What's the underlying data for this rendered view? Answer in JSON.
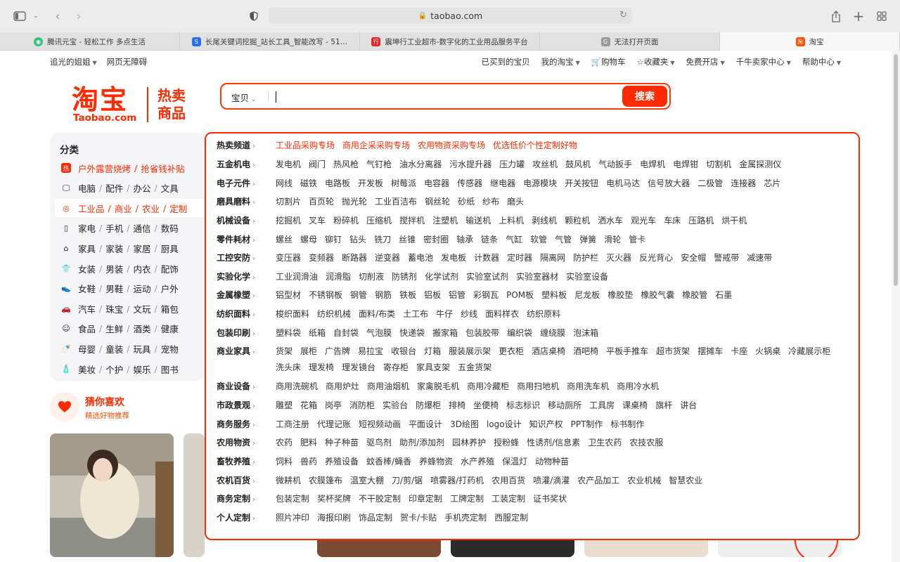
{
  "browser": {
    "url": "taobao.com",
    "tabs": [
      {
        "title": "腾讯元宝 - 轻松工作 多点生活",
        "color": "#31c27c",
        "glyph": "◉"
      },
      {
        "title": "长尾关键词挖掘_站长工具_智能改写 - 51…",
        "color": "#2b6ef2",
        "glyph": "S"
      },
      {
        "title": "震坤行工业超市-数字化的工业用品服务平台",
        "color": "#e3262b",
        "glyph": "行"
      },
      {
        "title": "无法打开页面",
        "color": "#9a9a9a",
        "glyph": "G"
      },
      {
        "title": "淘宝",
        "color": "#ff5000",
        "glyph": "淘"
      }
    ]
  },
  "topnav": {
    "left": [
      "追光的姐姐",
      "网页无障碍"
    ],
    "right": [
      "已买到的宝贝",
      "我的淘宝",
      "购物车",
      "收藏夹",
      "免费开店",
      "千牛卖家中心",
      "帮助中心"
    ]
  },
  "logo": {
    "main": "淘宝",
    "sub": "Taobao.com",
    "hot1": "热卖",
    "hot2": "商品"
  },
  "search": {
    "scope": "宝贝",
    "placeholder": "",
    "button": "搜索"
  },
  "categories": {
    "title": "分类",
    "rows": [
      {
        "icon": "hot",
        "items": [
          "户外露营烧烤",
          "抢省钱补贴"
        ]
      },
      {
        "icon": "monitor",
        "items": [
          "电脑",
          "配件",
          "办公",
          "文具"
        ]
      },
      {
        "icon": "target",
        "items": [
          "工业品",
          "商业",
          "农业",
          "定制"
        ]
      },
      {
        "icon": "phone",
        "items": [
          "家电",
          "手机",
          "通信",
          "数码"
        ]
      },
      {
        "icon": "sofa",
        "items": [
          "家具",
          "家装",
          "家居",
          "厨具"
        ]
      },
      {
        "icon": "shirt",
        "items": [
          "女装",
          "男装",
          "内衣",
          "配饰"
        ]
      },
      {
        "icon": "shoe",
        "items": [
          "女鞋",
          "男鞋",
          "运动",
          "户外"
        ]
      },
      {
        "icon": "car",
        "items": [
          "汽车",
          "珠宝",
          "文玩",
          "箱包"
        ]
      },
      {
        "icon": "food",
        "items": [
          "食品",
          "生鲜",
          "酒类",
          "健康"
        ]
      },
      {
        "icon": "baby",
        "items": [
          "母婴",
          "童装",
          "玩具",
          "宠物"
        ]
      },
      {
        "icon": "cosmetic",
        "items": [
          "美妆",
          "个护",
          "娱乐",
          "图书"
        ]
      }
    ]
  },
  "guess": {
    "title": "猜你喜欢",
    "sub": "精选好物推荐"
  },
  "panel": [
    {
      "label": "热卖频道",
      "items": [
        "工业品采购专场",
        "商用企采采购专场",
        "农用物资采购专场",
        "优选低价个性定制好物"
      ]
    },
    {
      "label": "五金机电",
      "items": [
        "发电机",
        "阀门",
        "热风枪",
        "气钉枪",
        "油水分离器",
        "污水提升器",
        "压力罐",
        "攻丝机",
        "鼓风机",
        "气动扳手",
        "电焊机",
        "电焊钳",
        "切割机",
        "金属探测仪"
      ]
    },
    {
      "label": "电子元件",
      "items": [
        "网线",
        "磁铁",
        "电路板",
        "开发板",
        "树莓派",
        "电容器",
        "传感器",
        "继电器",
        "电源模块",
        "开关按钮",
        "电机马达",
        "信号放大器",
        "二极管",
        "连接器",
        "芯片"
      ]
    },
    {
      "label": "磨具磨料",
      "items": [
        "切割片",
        "百页轮",
        "抛光轮",
        "工业百洁布",
        "钢丝轮",
        "砂纸",
        "纱布",
        "磨头"
      ]
    },
    {
      "label": "机械设备",
      "items": [
        "挖掘机",
        "叉车",
        "粉碎机",
        "压缩机",
        "搅拌机",
        "注塑机",
        "输送机",
        "上料机",
        "剥线机",
        "颗粒机",
        "洒水车",
        "观光车",
        "车床",
        "压路机",
        "烘干机"
      ]
    },
    {
      "label": "零件耗材",
      "items": [
        "螺丝",
        "螺母",
        "铆钉",
        "钻头",
        "铣刀",
        "丝锥",
        "密封圈",
        "轴承",
        "链条",
        "气缸",
        "软管",
        "气管",
        "弹簧",
        "滑轮",
        "管卡"
      ]
    },
    {
      "label": "工控安防",
      "items": [
        "变压器",
        "变频器",
        "断路器",
        "逆变器",
        "蓄电池",
        "发电板",
        "计数器",
        "定时器",
        "隔离网",
        "防护栏",
        "灭火器",
        "反光背心",
        "安全帽",
        "警戒带",
        "减速带"
      ]
    },
    {
      "label": "实验化学",
      "items": [
        "工业润滑油",
        "润滑脂",
        "切削液",
        "防锈剂",
        "化学试剂",
        "实验室试剂",
        "实验室器材",
        "实验室设备"
      ]
    },
    {
      "label": "金属橡塑",
      "items": [
        "铝型材",
        "不锈钢板",
        "钢管",
        "钢筋",
        "铁板",
        "铝板",
        "铝管",
        "彩钢瓦",
        "POM板",
        "塑料板",
        "尼龙板",
        "橡胶垫",
        "橡胶气囊",
        "橡胶管",
        "石墨"
      ]
    },
    {
      "label": "纺织面料",
      "items": [
        "梭织面料",
        "纺织机械",
        "面料/布类",
        "土工布",
        "牛仔",
        "纱线",
        "面料样衣",
        "纺织原料"
      ]
    },
    {
      "label": "包装印刷",
      "items": [
        "塑料袋",
        "纸箱",
        "自封袋",
        "气泡膜",
        "快递袋",
        "搬家箱",
        "包装胶带",
        "编织袋",
        "缠绕膜",
        "泡沫箱"
      ]
    },
    {
      "label": "商业家具",
      "items": [
        "货架",
        "展柜",
        "广告牌",
        "易拉宝",
        "收银台",
        "灯箱",
        "服装展示架",
        "更衣柜",
        "酒店桌椅",
        "酒吧椅",
        "平板手推车",
        "超市货架",
        "摆摊车",
        "卡座",
        "火锅桌",
        "冷藏展示柜",
        "洗头床",
        "理发椅",
        "理发镜台",
        "寄存柜",
        "家具支架",
        "五金货架"
      ]
    },
    {
      "label": "商业设备",
      "items": [
        "商用洗碗机",
        "商用炉灶",
        "商用油烟机",
        "家禽脱毛机",
        "商用冷藏柜",
        "商用扫地机",
        "商用洗车机",
        "商用冷水机"
      ]
    },
    {
      "label": "市政景观",
      "items": [
        "雕塑",
        "花箱",
        "岗亭",
        "消防柜",
        "实验台",
        "防爆柜",
        "排椅",
        "坐便椅",
        "标志标识",
        "移动厕所",
        "工具房",
        "课桌椅",
        "旗杆",
        "讲台"
      ]
    },
    {
      "label": "商务服务",
      "items": [
        "工商注册",
        "代理记账",
        "短视频动画",
        "平面设计",
        "3D绘图",
        "logo设计",
        "知识产权",
        "PPT制作",
        "标书制作"
      ]
    },
    {
      "label": "农用物资",
      "items": [
        "农药",
        "肥料",
        "种子种苗",
        "驱鸟剂",
        "助剂/添加剂",
        "园林养护",
        "授粉蜂",
        "性诱剂/信息素",
        "卫生农药",
        "农技农服"
      ]
    },
    {
      "label": "畜牧养殖",
      "items": [
        "饲料",
        "兽药",
        "养殖设备",
        "蚊香棒/蝇香",
        "养蜂物资",
        "水产养殖",
        "保温灯",
        "动物种苗"
      ]
    },
    {
      "label": "农机百货",
      "items": [
        "微耕机",
        "农膜篷布",
        "温室大棚",
        "刀/剪/锯",
        "喷雾器/打药机",
        "农用百货",
        "喷灌/滴灌",
        "农产品加工",
        "农业机械",
        "智慧农业"
      ]
    },
    {
      "label": "商务定制",
      "items": [
        "包装定制",
        "奖杯奖牌",
        "不干胶定制",
        "印章定制",
        "工牌定制",
        "工装定制",
        "证书奖状"
      ]
    },
    {
      "label": "个人定制",
      "items": [
        "照片冲印",
        "海报印刷",
        "饰品定制",
        "贺卡/卡贴",
        "手机壳定制",
        "西服定制"
      ]
    }
  ],
  "colors": {
    "brand": "#ff2a00",
    "accent": "#ff5000"
  }
}
